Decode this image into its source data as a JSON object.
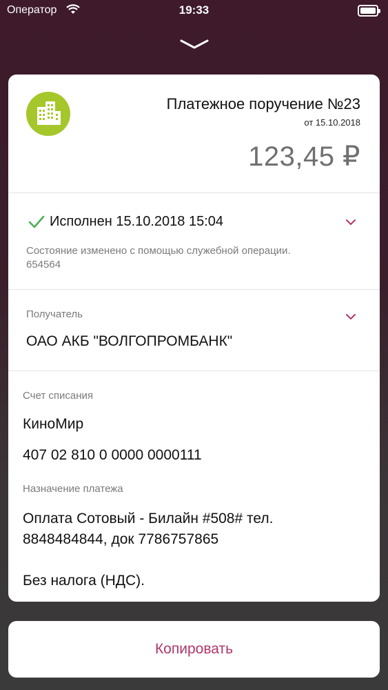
{
  "status_bar": {
    "carrier": "Оператор",
    "time": "19:33"
  },
  "header": {
    "logo_icon": "building-icon",
    "title": "Платежное поручение №23",
    "date": "от 15.10.2018",
    "amount": "123,45 ₽"
  },
  "status": {
    "text": "Исполнен 15.10.2018 15:04",
    "note": "Состояние изменено с помощью служебной операции. 654564"
  },
  "recipient": {
    "label": "Получатель",
    "value": "ОАО АКБ \"ВОЛГОПРОМБАНК\""
  },
  "debit_account": {
    "label": "Счет списания",
    "name": "КиноМир",
    "number": "407 02 810 0 0000 0000111"
  },
  "purpose": {
    "label": "Назначение платежа",
    "line1": "Оплата Сотовый - Билайн #508# тел.",
    "line2": "8848484844, док 7786757865",
    "line3": "Без налога (НДС)."
  },
  "actions": {
    "copy_label": "Копировать"
  },
  "colors": {
    "accent": "#b0356a",
    "logo_bg": "#a5c72c",
    "check": "#4caf50"
  }
}
